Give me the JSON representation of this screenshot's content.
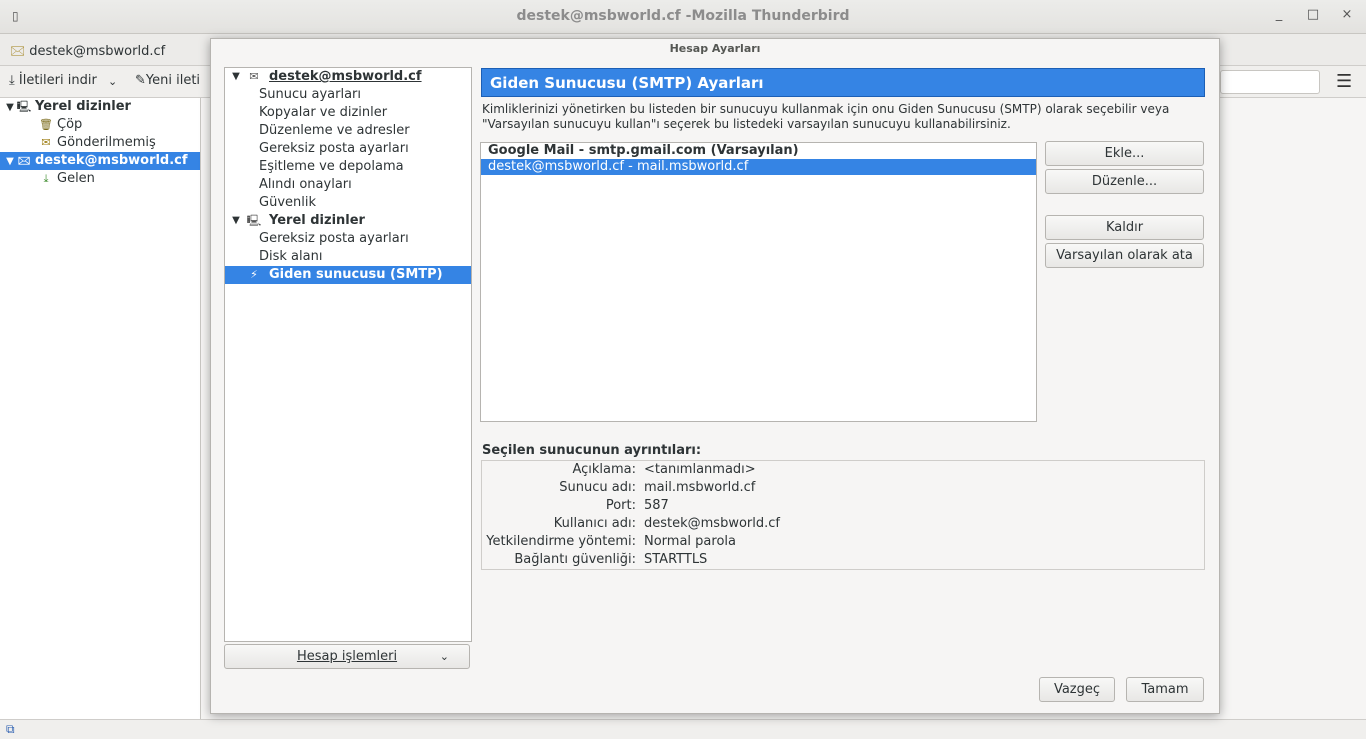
{
  "window": {
    "title": "destek@msbworld.cf -Mozilla Thunderbird",
    "minimize": "_",
    "maximize": "□",
    "close": "×"
  },
  "main": {
    "tab_label": "destek@msbworld.cf",
    "toolbar": {
      "get_messages": "İletileri indir",
      "new_message": "Yeni ileti"
    },
    "folders": [
      {
        "label": "Yerel dizinler",
        "level": 0,
        "icon": "computer-icon"
      },
      {
        "label": "Çöp",
        "level": 1,
        "icon": "trash-icon"
      },
      {
        "label": "Gönderilmemiş",
        "level": 1,
        "icon": "outbox-icon"
      },
      {
        "label": "destek@msbworld.cf",
        "level": 0,
        "icon": "mail-account-icon"
      },
      {
        "label": "Gelen",
        "level": 1,
        "icon": "inbox-icon"
      }
    ]
  },
  "dialog": {
    "title": "Hesap Ayarları",
    "tree": {
      "account": "destek@msbworld.cf",
      "account_items": [
        "Sunucu ayarları",
        "Kopyalar ve dizinler",
        "Düzenleme ve adresler",
        "Gereksiz posta ayarları",
        "Eşitleme ve depolama",
        "Alındı onayları",
        "Güvenlik"
      ],
      "local": "Yerel dizinler",
      "local_items": [
        "Gereksiz posta ayarları",
        "Disk alanı"
      ],
      "smtp": "Giden sunucusu (SMTP)"
    },
    "account_actions": "Hesap işlemleri",
    "panel_title": "Giden Sunucusu (SMTP) Ayarları",
    "description": "Kimliklerinizi yönetirken bu listeden bir sunucuyu kullanmak için onu Giden Sunucusu (SMTP) olarak seçebilir veya \"Varsayılan sunucuyu kullan\"ı seçerek bu listedeki varsayılan sunucuyu kullanabilirsiniz.",
    "servers": [
      {
        "label": "Google Mail - smtp.gmail.com (Varsayılan)",
        "default": true
      },
      {
        "label": "destek@msbworld.cf - mail.msbworld.cf",
        "selected": true
      }
    ],
    "buttons": {
      "add": "Ekle...",
      "edit": "Düzenle...",
      "remove": "Kaldır",
      "set_default": "Varsayılan olarak ata",
      "cancel": "Vazgeç",
      "ok": "Tamam"
    },
    "details_title": "Seçilen sunucunun ayrıntıları:",
    "details": [
      {
        "key": "Açıklama:",
        "value": "<tanımlanmadı>"
      },
      {
        "key": "Sunucu adı:",
        "value": "mail.msbworld.cf"
      },
      {
        "key": "Port:",
        "value": "587"
      },
      {
        "key": "Kullanıcı adı:",
        "value": "destek@msbworld.cf"
      },
      {
        "key": "Yetkilendirme yöntemi:",
        "value": "Normal parola"
      },
      {
        "key": "Bağlantı güvenliği:",
        "value": "STARTTLS"
      }
    ],
    "accent_color": "#3584e4"
  }
}
